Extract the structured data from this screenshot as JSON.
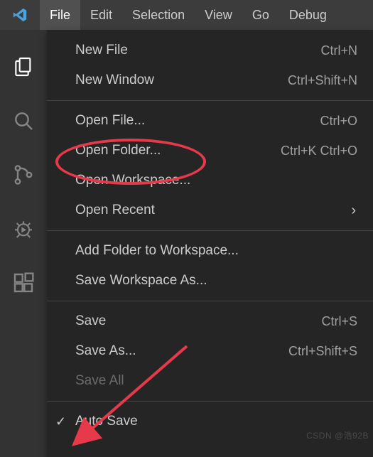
{
  "menubar": {
    "items": [
      "File",
      "Edit",
      "Selection",
      "View",
      "Go",
      "Debug"
    ],
    "active_index": 0
  },
  "activitybar": {
    "icons": [
      {
        "name": "files-icon"
      },
      {
        "name": "search-icon"
      },
      {
        "name": "source-control-icon"
      },
      {
        "name": "debug-icon"
      },
      {
        "name": "extensions-icon"
      }
    ],
    "active_index": 0
  },
  "file_menu": {
    "groups": [
      [
        {
          "label": "New File",
          "shortcut": "Ctrl+N"
        },
        {
          "label": "New Window",
          "shortcut": "Ctrl+Shift+N"
        }
      ],
      [
        {
          "label": "Open File...",
          "shortcut": "Ctrl+O"
        },
        {
          "label": "Open Folder...",
          "shortcut": "Ctrl+K Ctrl+O"
        },
        {
          "label": "Open Workspace..."
        },
        {
          "label": "Open Recent",
          "submenu": true
        }
      ],
      [
        {
          "label": "Add Folder to Workspace..."
        },
        {
          "label": "Save Workspace As..."
        }
      ],
      [
        {
          "label": "Save",
          "shortcut": "Ctrl+S"
        },
        {
          "label": "Save As...",
          "shortcut": "Ctrl+Shift+S"
        },
        {
          "label": "Save All",
          "disabled": true
        }
      ],
      [
        {
          "label": "Auto Save",
          "checked": true
        }
      ]
    ]
  },
  "annotations": {
    "circled_item": "Open Folder...",
    "arrow_target": "Auto Save"
  },
  "watermark": "CSDN @浩92B"
}
